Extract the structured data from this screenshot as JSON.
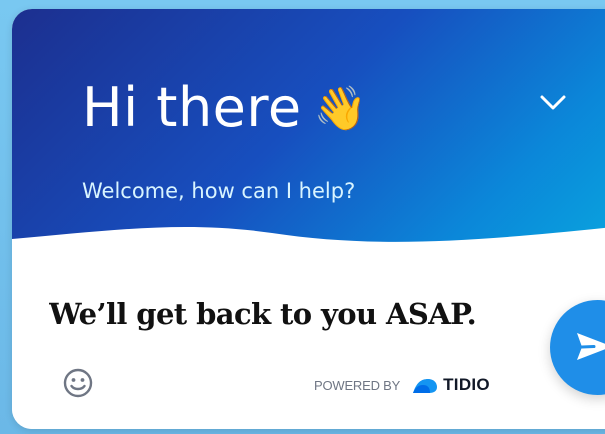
{
  "widget": {
    "header": {
      "title": "Hi there",
      "wave_emoji": "👋",
      "subtitle": "Welcome, how can I help?",
      "collapse_icon": "chevron-down-icon"
    },
    "composer": {
      "placeholder": "We’ll get back to you ASAP.",
      "emoji_icon": "smiley-icon",
      "send_icon": "send-icon"
    },
    "branding": {
      "powered_by": "POWERED BY",
      "brand": "TIDIO"
    }
  },
  "colors": {
    "header_start": "#1c2f8f",
    "header_mid": "#174fbf",
    "header_end": "#09a8df",
    "send_button": "#1f8ee8",
    "page_background": "#79c8f1"
  }
}
